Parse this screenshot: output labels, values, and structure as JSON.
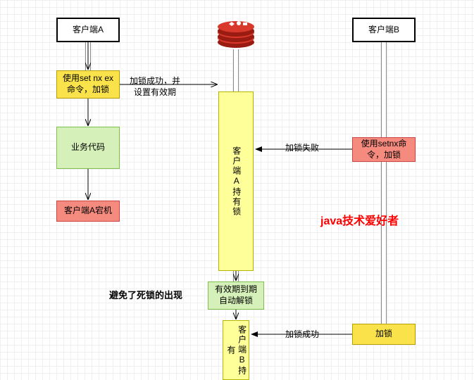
{
  "nodes": {
    "clientA": "客户端A",
    "clientB": "客户端B",
    "setnxex": "使用set nx ex命令，加锁",
    "bizcode": "业务代码",
    "acrash": "客户端A宕机",
    "aholds": "客户端A持有锁",
    "bholds": "客户端B持有",
    "expire": "有效期到期自动解锁",
    "setnx_b": "使用setnx命令，加锁",
    "lock_b": "加锁"
  },
  "labels": {
    "lock_ok_set": "加锁成功，并设置有效期",
    "lock_fail": "加锁失败",
    "lock_ok": "加锁成功",
    "avoid_deadlock": "避免了死锁的出现",
    "watermark": "java技术爱好者"
  },
  "icons": {
    "redis": "redis-icon"
  }
}
